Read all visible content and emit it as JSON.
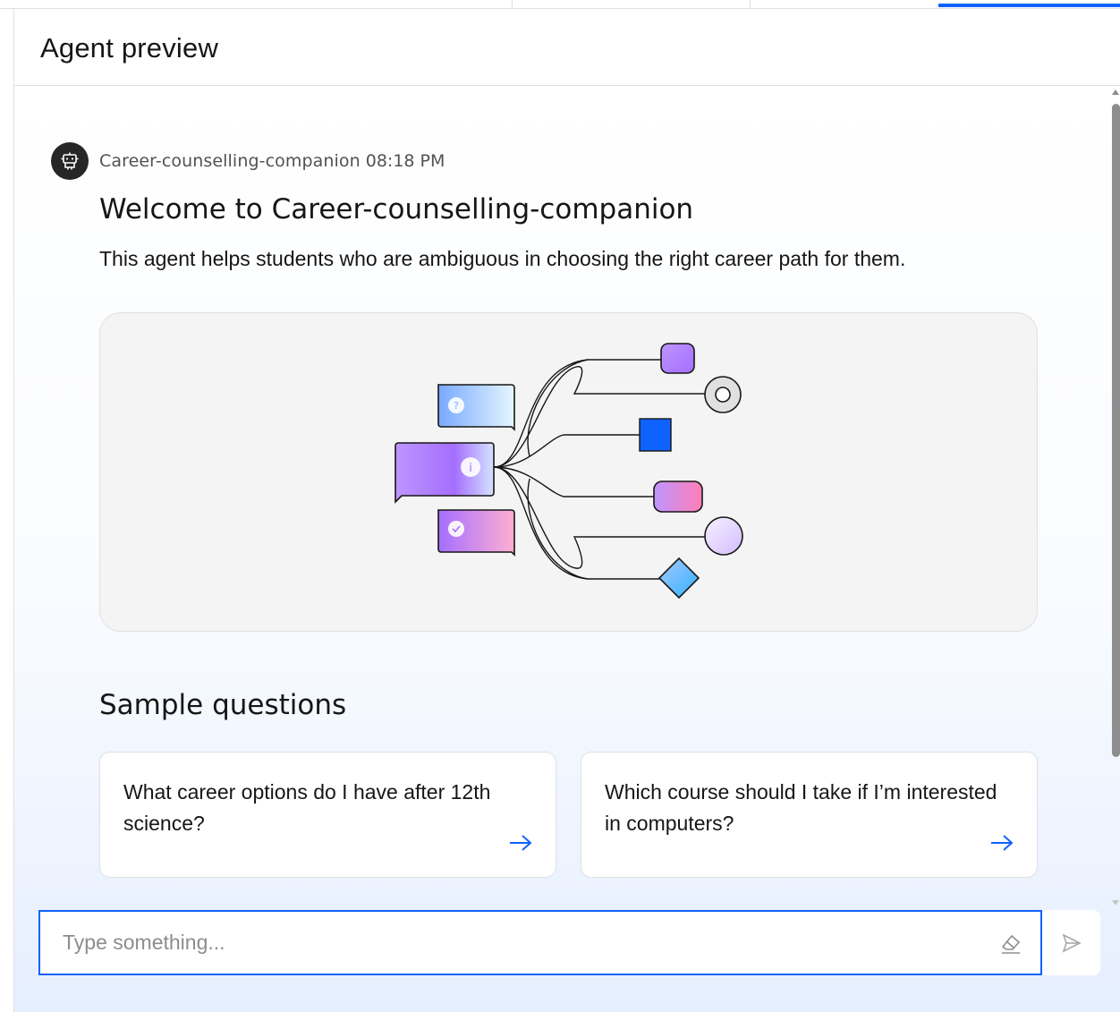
{
  "header": {
    "title": "Agent preview"
  },
  "message": {
    "agent_name": "Career-counselling-companion",
    "timestamp": "08:18 PM",
    "welcome_title": "Welcome to Career-counselling-companion",
    "description": "This agent helps students who are ambiguous in choosing the right career path for them."
  },
  "sample_questions": {
    "title": "Sample questions",
    "items": [
      {
        "text": "What career options do I have after 12th science?"
      },
      {
        "text": "Which course should I take if I’m interested in computers?"
      }
    ]
  },
  "composer": {
    "placeholder": "Type something...",
    "value": ""
  },
  "icons": {
    "avatar": "robot-icon",
    "question_arrow": "arrow-right-icon",
    "clear": "eraser-icon",
    "send": "send-icon"
  },
  "colors": {
    "accent": "#0f62fe",
    "avatar_bg": "#262626",
    "illustration_bg": "#f4f4f4"
  }
}
